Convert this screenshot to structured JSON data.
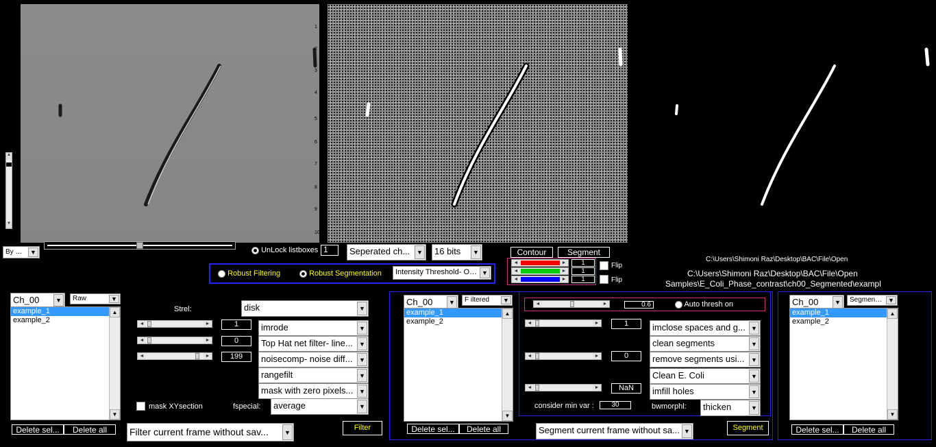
{
  "top": {
    "view_select": "By m...",
    "unlock_label": "UnLock listboxes",
    "unlock_value": "1",
    "channel_mode": "Seperated ch...",
    "bits": "16 bits",
    "contour": "Contour",
    "segment": "Segment",
    "flip1": "Flip",
    "flip2": "Flip",
    "rgb_values": [
      "1",
      "1",
      "1"
    ],
    "path_small": "C:\\Users\\Shimoni Raz\\Desktop\\BAC\\File\\Open",
    "path_line2": "C:\\Users\\Shimoni Raz\\Desktop\\BAC\\File\\Open",
    "path_line3": "Samples\\E_Coli_Phase_contrast\\ch00_Segmented\\exampl"
  },
  "robust": {
    "filtering": "Robust Filtering",
    "segmentation": "Robust Segmentation",
    "method": "Intensity Threshold- Ot..."
  },
  "axis_ticks": [
    "1",
    "2",
    "3",
    "4",
    "5",
    "6",
    "7",
    "8",
    "9",
    "10"
  ],
  "left_panel": {
    "channel": "Ch_00",
    "type": "Raw",
    "items": [
      "example_1",
      "example_2"
    ],
    "delete_sel": "Delete sel...",
    "delete_all": "Delete all",
    "action": "Filter current frame without sav...",
    "filter_btn": "Filter"
  },
  "filter_panel": {
    "strel_label": "Strel:",
    "strel": "disk",
    "val1": "1",
    "val2": "0",
    "val3": "199",
    "ops": [
      "imrode",
      "Top Hat net filter- line...",
      "noisecomp- noise diff...",
      "rangefilt",
      "mask with zero pixels..."
    ],
    "mask_label": "mask XYsection",
    "fspecial_label": "fspecial:",
    "fspecial": "average"
  },
  "mid_panel": {
    "channel": "Ch_00",
    "type": "F iltered",
    "items": [
      "example_1",
      "example_2"
    ],
    "delete_sel": "Delete sel...",
    "delete_all": "Delete all",
    "action": "Segment current frame without sa...",
    "segment_btn": "Segment"
  },
  "seg_panel": {
    "thresh": "0.6",
    "auto": "Auto thresh on",
    "v1": "1",
    "v2": "0",
    "v3": "NaN",
    "min_var_label": "consider min var :",
    "min_var": "30",
    "ops": [
      "imclose spaces and g...",
      "clean segments",
      "remove segments usi...",
      "Clean E. Coli",
      "imfill holes"
    ],
    "bwmorph_label": "bwmorphl:",
    "bwmorph": "thicken"
  },
  "right_panel": {
    "channel": "Ch_00",
    "type": "Segmented",
    "items": [
      "example_1",
      "example_2"
    ],
    "delete_sel": "Delete sel...",
    "delete_all": "Delete all"
  }
}
